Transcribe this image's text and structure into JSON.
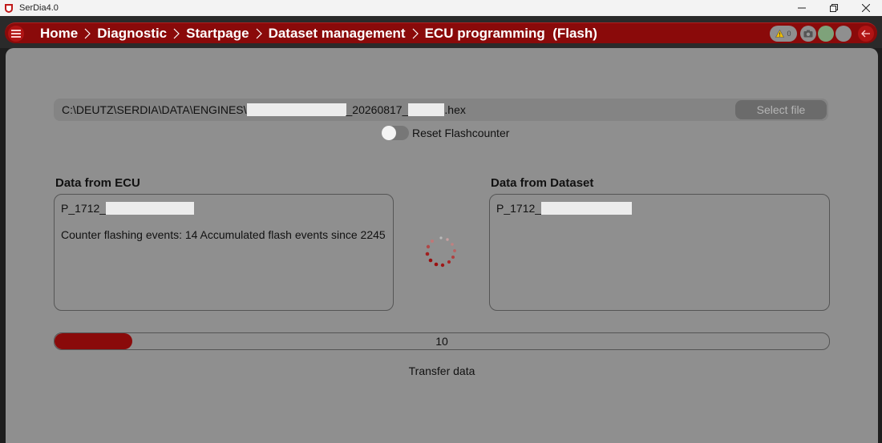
{
  "window": {
    "title": "SerDia4.0",
    "controls": [
      "minimize",
      "restore",
      "close"
    ]
  },
  "header": {
    "menu_icon": "hamburger-icon",
    "breadcrumb": [
      "Home",
      "Diagnostic",
      "Startpage",
      "Dataset management",
      "ECU programming  (Flash)"
    ],
    "warning_count": "0",
    "back_icon": "arrow-left-icon",
    "colors": {
      "brand": "#8a0a0a",
      "brand_light": "#b01414",
      "indicator_green": "#7ea27a"
    }
  },
  "file": {
    "path_prefix": "C:\\DEUTZ\\SERDIA\\DATA\\ENGINES\\",
    "path_middle": "_20260817_",
    "path_suffix": ".hex",
    "select_label": "Select file"
  },
  "reset_toggle": {
    "label": "Reset Flashcounter",
    "checked": false
  },
  "ecu": {
    "title": "Data from ECU",
    "id_prefix": "P_1712_",
    "counter_text": "Counter flashing events: 14 Accumulated flash events since 2245"
  },
  "dataset": {
    "title": "Data from Dataset",
    "id_prefix": "P_1712_"
  },
  "progress": {
    "value": 10,
    "label": "10"
  },
  "status": {
    "text": "Transfer data"
  }
}
